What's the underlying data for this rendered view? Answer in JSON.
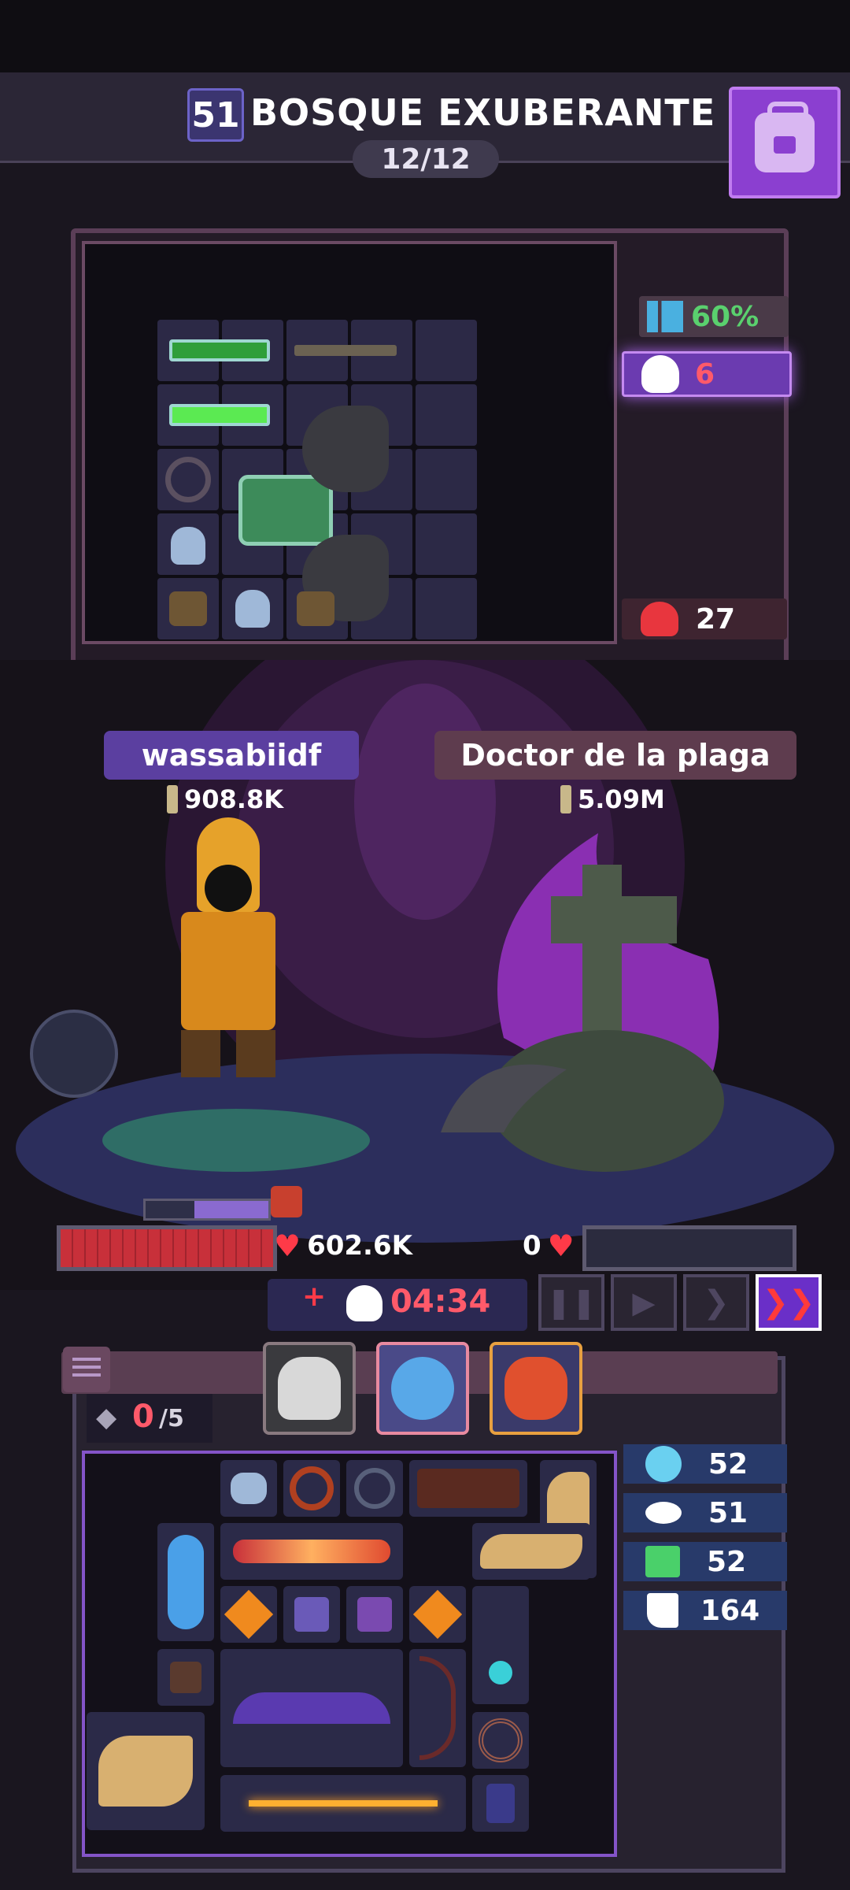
{
  "header": {
    "level": "51",
    "zone": "BOSQUE EXUBERANTE",
    "wave": "12/12"
  },
  "enemy_panel": {
    "stats": [
      {
        "icon": "bars-icon",
        "value": "60%",
        "color": "#5ad06e"
      },
      {
        "icon": "skull-icon",
        "value": "6",
        "color": "#ff5a6a"
      },
      {
        "icon": "rage-icon",
        "value": "27",
        "color": "#ffffff"
      }
    ]
  },
  "player": {
    "name": "wassabiidf",
    "power": "908.8K",
    "hp": "602.6K"
  },
  "enemy": {
    "name": "Doctor de la plaga",
    "power": "5.09M",
    "hp": "0"
  },
  "battle": {
    "plus": "+",
    "timer": "04:34"
  },
  "inventory": {
    "gems": "0",
    "gems_max": "/5",
    "stats": [
      {
        "icon": "orb-icon",
        "value": "52"
      },
      {
        "icon": "eye-icon",
        "value": "51"
      },
      {
        "icon": "scroll-icon",
        "value": "52"
      },
      {
        "icon": "boot-icon",
        "value": "164"
      }
    ]
  },
  "colors": {
    "accent_purple": "#8b3fd0",
    "hp_red": "#c8303a",
    "enemy_bar": "#2b2b3e"
  }
}
